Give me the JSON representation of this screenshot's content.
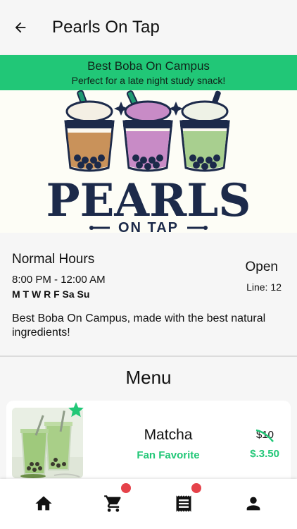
{
  "header": {
    "title": "Pearls On Tap",
    "back_icon": "arrow-back-icon"
  },
  "banner": {
    "title": "Best Boba On Campus",
    "subtitle": "Perfect for a late night study snack!",
    "color": "#21c777"
  },
  "hero": {
    "logo_line1": "PEARLS",
    "logo_line2": "ON TAP",
    "cups": [
      "brown-tea",
      "taro",
      "matcha"
    ]
  },
  "info": {
    "hours_title": "Normal Hours",
    "hours_time": "8:00 PM - 12:00 AM",
    "hours_days": "M T W R F Sa Su",
    "status": "Open",
    "line_label": "Line:",
    "line_value": "12",
    "description": "Best Boba On Campus, made with the best natural ingredients!"
  },
  "menu": {
    "heading": "Menu",
    "items": [
      {
        "name": "Matcha",
        "tag": "Fan Favorite",
        "old_price": "$10",
        "new_price": "$.3.50",
        "badge_icon": "star-icon"
      }
    ]
  },
  "nav": {
    "items": [
      {
        "icon": "home-icon",
        "badge": false
      },
      {
        "icon": "cart-icon",
        "badge": true
      },
      {
        "icon": "receipt-icon",
        "badge": true
      },
      {
        "icon": "person-icon",
        "badge": false
      }
    ],
    "badge_color": "#e5424a"
  }
}
